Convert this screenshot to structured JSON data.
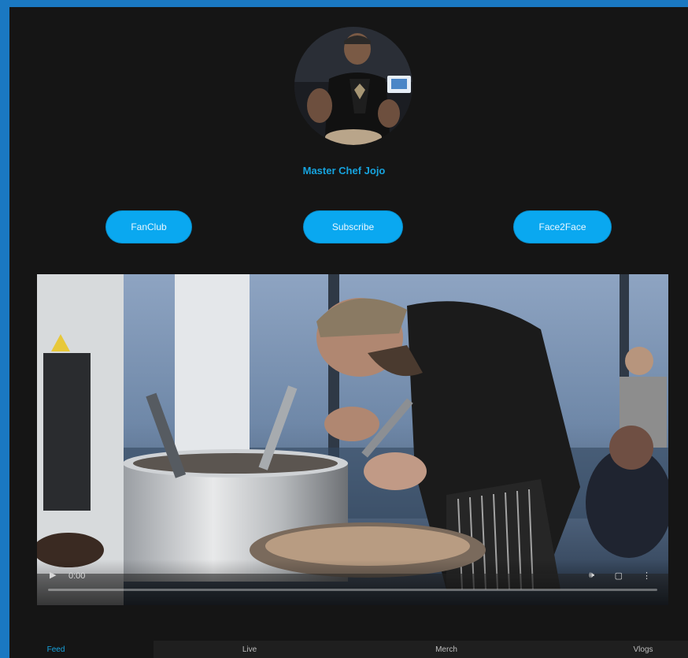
{
  "profile": {
    "name": "Master Chef Jojo"
  },
  "actions": {
    "fanclub_label": "FanClub",
    "subscribe_label": "Subscribe",
    "face2face_label": "Face2Face"
  },
  "video": {
    "current_time": "0:00",
    "progress": 0
  },
  "tabs": [
    {
      "label": "Feed",
      "active": true
    },
    {
      "label": "Live",
      "active": false
    },
    {
      "label": "Merch",
      "active": false
    },
    {
      "label": "Vlogs",
      "active": false
    }
  ],
  "colors": {
    "accent": "#0aa8f0",
    "accent_text": "#16a3de",
    "background": "#151515",
    "frame_border": "#1a78c2"
  },
  "icons": {
    "play": "play-icon",
    "volume": "volume-icon",
    "fullscreen": "fullscreen-icon",
    "more": "more-options-icon"
  }
}
